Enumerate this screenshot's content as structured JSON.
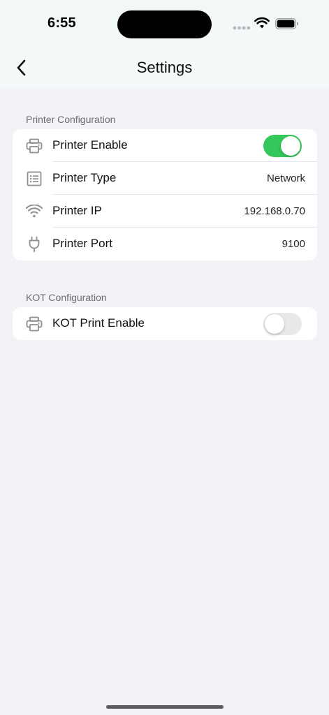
{
  "status_bar": {
    "time": "6:55",
    "icons": [
      "signal-dots-icon",
      "wifi-icon",
      "battery-icon"
    ]
  },
  "nav": {
    "back_icon": "chevron-left-icon",
    "title": "Settings"
  },
  "sections": [
    {
      "header": "Printer Configuration",
      "rows": [
        {
          "icon": "printer-icon",
          "label": "Printer Enable",
          "type": "toggle",
          "enabled": true
        },
        {
          "icon": "list-icon",
          "label": "Printer Type",
          "value": "Network"
        },
        {
          "icon": "wifi-icon",
          "label": "Printer IP",
          "value": "192.168.0.70"
        },
        {
          "icon": "plug-icon",
          "label": "Printer Port",
          "value": "9100"
        }
      ]
    },
    {
      "header": "KOT Configuration",
      "rows": [
        {
          "icon": "printer-icon",
          "label": "KOT Print Enable",
          "type": "toggle",
          "enabled": false
        }
      ]
    }
  ],
  "colors": {
    "toggle_on": "#34c759",
    "toggle_off": "#e9e9eb",
    "background": "#f2f2f7",
    "icon_gray": "#8e8e93"
  }
}
